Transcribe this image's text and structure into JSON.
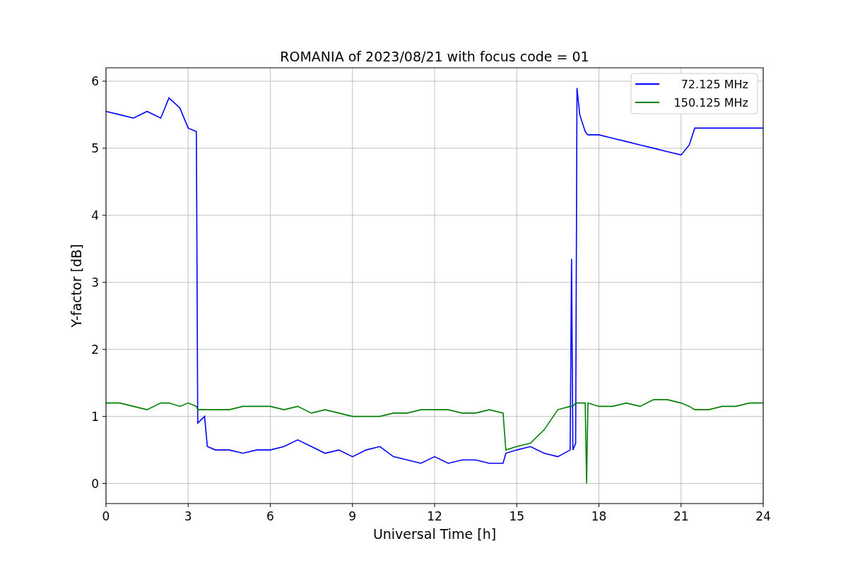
{
  "figure": {
    "chart_data": {
      "type": "line",
      "title": "ROMANIA of 2023/08/21 with focus code = 01",
      "xlabel": "Universal Time [h]",
      "ylabel": "Y-factor [dB]",
      "x": [
        0,
        0.5,
        1,
        1.5,
        2,
        2.3,
        2.7,
        3,
        3.3,
        3.35,
        3.6,
        3.7,
        4,
        4.5,
        5,
        5.5,
        6,
        6.5,
        7,
        7.5,
        8,
        8.5,
        9,
        9.5,
        10,
        10.5,
        11,
        11.5,
        12,
        12.5,
        13,
        13.5,
        14,
        14.5,
        14.6,
        15,
        15.5,
        16,
        16.5,
        16.95,
        17,
        17.05,
        17.15,
        17.2,
        17.3,
        17.5,
        17.55,
        17.6,
        18,
        18.5,
        19,
        19.5,
        20,
        20.5,
        21,
        21.3,
        21.5,
        22,
        22.5,
        23,
        23.5,
        24
      ],
      "series": [
        {
          "name": "72.125 MHz",
          "color": "#0000ff",
          "values": [
            5.55,
            5.5,
            5.45,
            5.55,
            5.45,
            5.75,
            5.6,
            5.3,
            5.25,
            0.9,
            1.0,
            0.55,
            0.5,
            0.5,
            0.45,
            0.5,
            0.5,
            0.55,
            0.65,
            0.55,
            0.45,
            0.5,
            0.4,
            0.5,
            0.55,
            0.4,
            0.35,
            0.3,
            0.4,
            0.3,
            0.35,
            0.35,
            0.3,
            0.3,
            0.45,
            0.5,
            0.55,
            0.45,
            0.4,
            0.5,
            3.35,
            0.5,
            0.6,
            5.9,
            5.5,
            5.25,
            5.22,
            5.2,
            5.2,
            5.15,
            5.1,
            5.05,
            5.0,
            4.95,
            4.9,
            5.05,
            5.3,
            5.3,
            5.3,
            5.3,
            5.3,
            5.3
          ]
        },
        {
          "name": "150.125 MHz",
          "color": "#008000",
          "values": [
            1.2,
            1.2,
            1.15,
            1.1,
            1.2,
            1.2,
            1.15,
            1.2,
            1.15,
            1.1,
            1.1,
            1.1,
            1.1,
            1.1,
            1.15,
            1.15,
            1.15,
            1.1,
            1.15,
            1.05,
            1.1,
            1.05,
            1.0,
            1.0,
            1.0,
            1.05,
            1.05,
            1.1,
            1.1,
            1.1,
            1.05,
            1.05,
            1.1,
            1.05,
            0.5,
            0.55,
            0.6,
            0.8,
            1.1,
            1.15,
            1.15,
            1.15,
            1.2,
            1.2,
            1.2,
            1.2,
            0.0,
            1.2,
            1.15,
            1.15,
            1.2,
            1.15,
            1.25,
            1.25,
            1.2,
            1.15,
            1.1,
            1.1,
            1.15,
            1.15,
            1.2,
            1.2
          ]
        }
      ],
      "grid": true,
      "legend": true,
      "xlim": [
        0,
        24
      ],
      "ylim": [
        -0.3,
        6.2
      ],
      "xticks": [
        0,
        3,
        6,
        9,
        12,
        15,
        18,
        21,
        24
      ],
      "yticks": [
        0,
        1,
        2,
        3,
        4,
        5,
        6
      ]
    }
  }
}
